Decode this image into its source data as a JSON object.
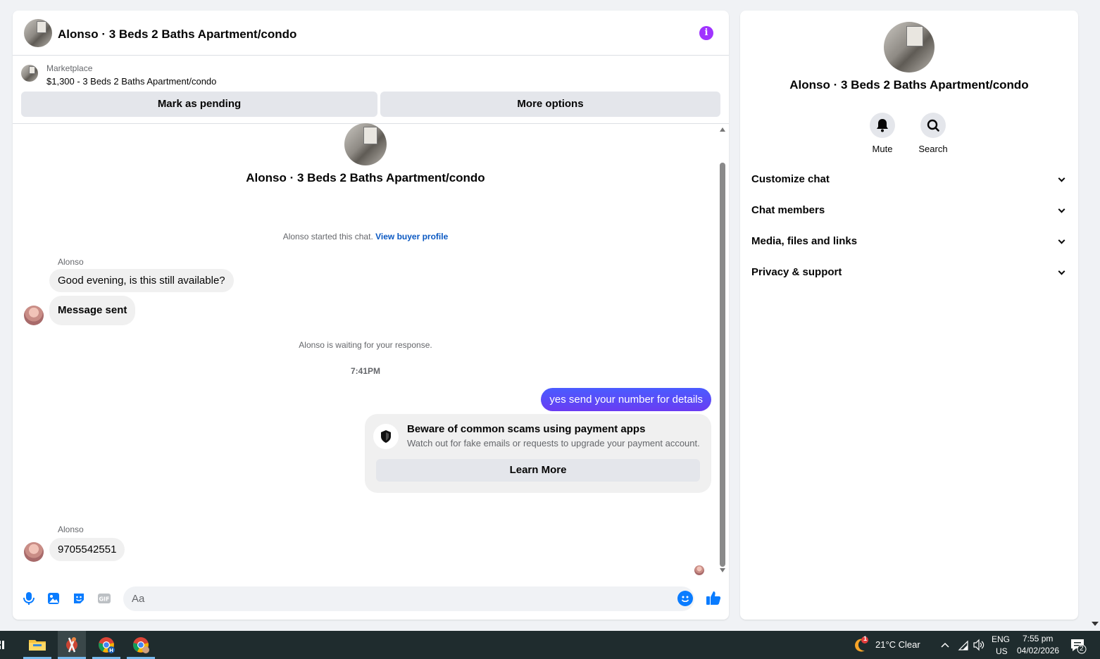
{
  "header": {
    "title": "Alonso · 3 Beds 2 Baths Apartment/condo",
    "info_icon_glyph": "i"
  },
  "marketplace": {
    "label": "Marketplace",
    "listing": "$1,300 - 3 Beds 2 Baths Apartment/condo",
    "mark_pending_label": "Mark as pending",
    "more_options_label": "More options"
  },
  "conversation": {
    "title": "Alonso · 3 Beds 2 Baths Apartment/condo",
    "started_text": "Alonso started this chat.",
    "view_profile_link": "View buyer profile",
    "waiting_text": "Alonso is waiting for your response.",
    "timestamp": "7:41PM",
    "messages": [
      {
        "sender": "Alonso",
        "text": "Good evening, is this still available?"
      },
      {
        "text": "Message sent"
      },
      {
        "text": "yes send your number for details",
        "outgoing": true
      },
      {
        "sender": "Alonso",
        "text": "9705542551"
      }
    ],
    "scam_card": {
      "title": "Beware of common scams using payment apps",
      "subtitle": "Watch out for fake emails or requests to upgrade your payment account.",
      "button_label": "Learn More"
    }
  },
  "composer": {
    "placeholder": "Aa",
    "gif_label": "GIF"
  },
  "info_panel": {
    "title": "Alonso · 3 Beds 2 Baths Apartment/condo",
    "actions": [
      "Mute",
      "Search"
    ],
    "sections": [
      "Customize chat",
      "Chat members",
      "Media, files and links",
      "Privacy & support"
    ]
  },
  "taskbar": {
    "notification_badge": "1",
    "weather": "21°C  Clear",
    "language": "ENG",
    "region": "US",
    "time": "7:55 pm",
    "date": "04/02/2026",
    "notification_count": "2"
  },
  "colors": {
    "accent": "#0a7cff",
    "outgoing_bubble": "#5b41f5",
    "info_icon": "#a033ff",
    "link": "#0a58c2"
  }
}
